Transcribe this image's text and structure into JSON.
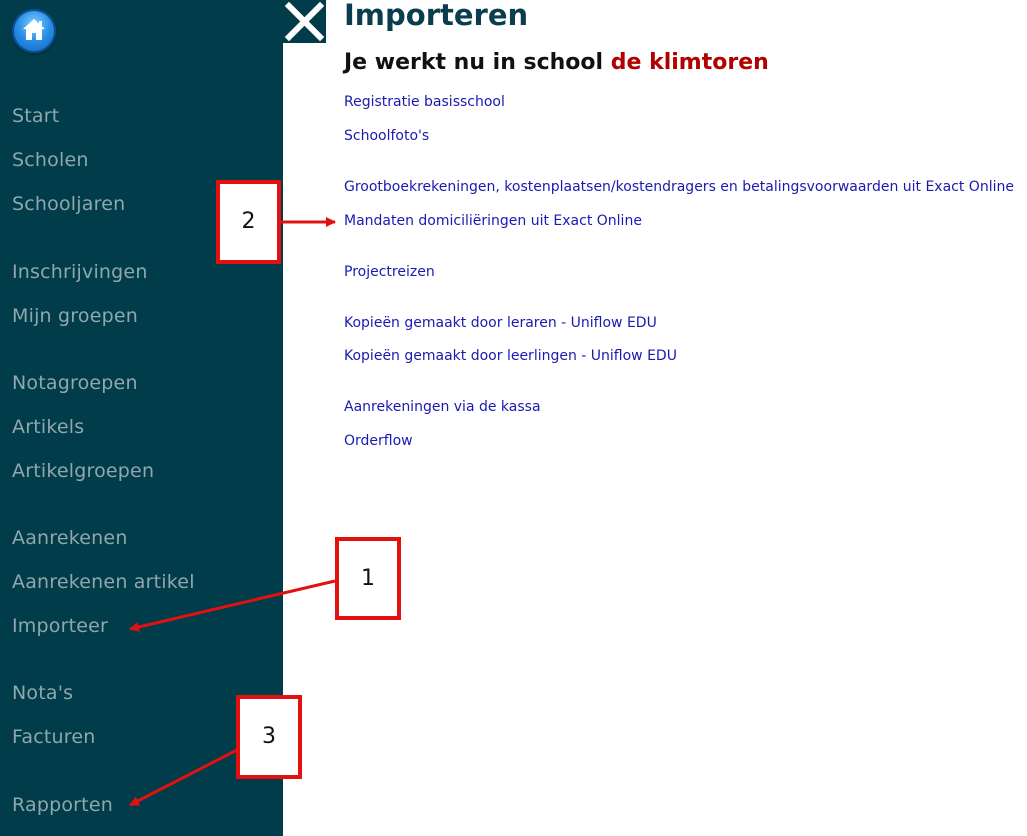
{
  "sidebar": {
    "items": [
      {
        "key": "start",
        "label": "Start"
      },
      {
        "key": "scholen",
        "label": "Scholen"
      },
      {
        "key": "schooljaren",
        "label": "Schooljaren"
      },
      {
        "key": "inschrijvingen",
        "label": "Inschrijvingen"
      },
      {
        "key": "mijn-groepen",
        "label": "Mijn groepen"
      },
      {
        "key": "notagroepen",
        "label": "Notagroepen"
      },
      {
        "key": "artikels",
        "label": "Artikels"
      },
      {
        "key": "artikelgroepen",
        "label": "Artikelgroepen"
      },
      {
        "key": "aanrekenen",
        "label": "Aanrekenen"
      },
      {
        "key": "aanrekenen-artikel",
        "label": "Aanrekenen artikel"
      },
      {
        "key": "importeer",
        "label": "Importeer"
      },
      {
        "key": "notas",
        "label": "Nota's"
      },
      {
        "key": "facturen",
        "label": "Facturen"
      },
      {
        "key": "rapporten",
        "label": "Rapporten"
      }
    ],
    "home_icon": "home-icon"
  },
  "header": {
    "close_icon": "close-icon",
    "title": "Importeren",
    "subtitle_prefix": "Je werkt nu in school",
    "school_name": "de klimtoren"
  },
  "links": [
    {
      "label": "Registratie basisschool"
    },
    {
      "label": "Schoolfoto's"
    },
    {
      "label": "Grootboekrekeningen, kostenplaatsen/kostendragers en betalingsvoorwaarden uit Exact Online"
    },
    {
      "label": "Mandaten domiciliëringen uit Exact Online"
    },
    {
      "label": "Projectreizen"
    },
    {
      "label": "Kopieën gemaakt door leraren - Uniflow EDU"
    },
    {
      "label": "Kopieën gemaakt door leerlingen - Uniflow EDU"
    },
    {
      "label": "Aanrekeningen via de kassa"
    },
    {
      "label": "Orderflow"
    }
  ],
  "callouts": [
    {
      "number": "1"
    },
    {
      "number": "2"
    },
    {
      "number": "3"
    }
  ],
  "colors": {
    "sidebar_bg": "#003c4a",
    "nav_text": "#8fa7ad",
    "link": "#1a1ab0",
    "school_name": "#b20000",
    "callout_border": "#e31010"
  }
}
